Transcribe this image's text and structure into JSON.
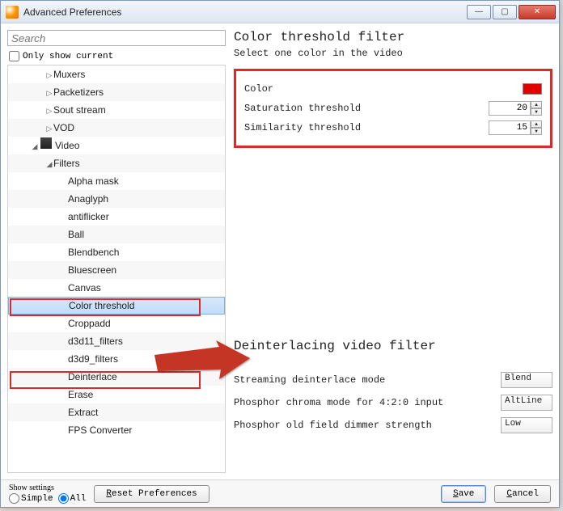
{
  "titlebar": {
    "title": "Advanced Preferences"
  },
  "search": {
    "placeholder": "Search"
  },
  "only_current": {
    "label": "Only show current"
  },
  "tree": {
    "items": [
      {
        "label": "Muxers",
        "depth": 2,
        "arrow": "▷"
      },
      {
        "label": "Packetizers",
        "depth": 2,
        "arrow": "▷"
      },
      {
        "label": "Sout stream",
        "depth": 2,
        "arrow": "▷"
      },
      {
        "label": "VOD",
        "depth": 2,
        "arrow": "▷"
      },
      {
        "label": "Video",
        "depth": 1,
        "arrow": "◢",
        "icon": "video"
      },
      {
        "label": "Filters",
        "depth": 2,
        "arrow": "◢"
      },
      {
        "label": "Alpha mask",
        "depth": 3
      },
      {
        "label": "Anaglyph",
        "depth": 3
      },
      {
        "label": "antiflicker",
        "depth": 3
      },
      {
        "label": "Ball",
        "depth": 3
      },
      {
        "label": "Blendbench",
        "depth": 3
      },
      {
        "label": "Bluescreen",
        "depth": 3
      },
      {
        "label": "Canvas",
        "depth": 3
      },
      {
        "label": "Color threshold",
        "depth": 3,
        "selected": true
      },
      {
        "label": "Croppadd",
        "depth": 3
      },
      {
        "label": "d3d11_filters",
        "depth": 3
      },
      {
        "label": "d3d9_filters",
        "depth": 3
      },
      {
        "label": "Deinterlace",
        "depth": 3
      },
      {
        "label": "Erase",
        "depth": 3
      },
      {
        "label": "Extract",
        "depth": 3
      },
      {
        "label": "FPS Converter",
        "depth": 3
      }
    ]
  },
  "section1": {
    "title": "Color threshold filter",
    "subtitle": "Select one color in the video",
    "color_label": "Color",
    "color_value": "#e00000",
    "sat_label": "Saturation threshold",
    "sat_value": "20",
    "sim_label": "Similarity threshold",
    "sim_value": "15"
  },
  "section2": {
    "title": "Deinterlacing video filter",
    "mode_label": "Streaming deinterlace mode",
    "mode_value": "Blend",
    "phos_label": "Phosphor chroma mode for 4:2:0 input",
    "phos_value": "AltLine",
    "dim_label": "Phosphor old field dimmer strength",
    "dim_value": "Low"
  },
  "footer": {
    "show_settings": "Show settings",
    "simple": "Simple",
    "all": "All",
    "reset": "Reset Preferences",
    "save": "Save",
    "cancel": "Cancel"
  }
}
